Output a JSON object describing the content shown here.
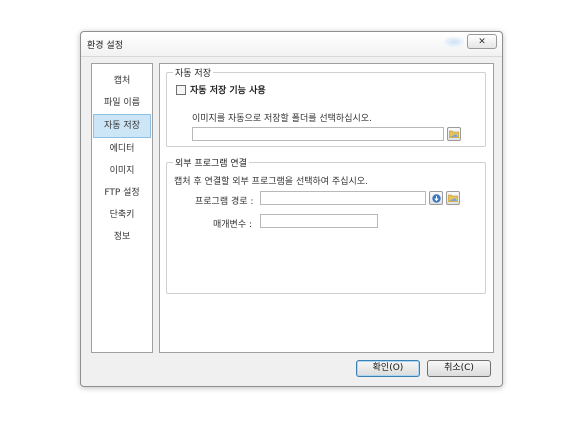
{
  "window": {
    "title": "환경 설정",
    "close_label": "✕"
  },
  "sidebar": {
    "items": [
      {
        "label": "캡처"
      },
      {
        "label": "파일 이름"
      },
      {
        "label": "자동 저장"
      },
      {
        "label": "에디터"
      },
      {
        "label": "이미지"
      },
      {
        "label": "FTP 설정"
      },
      {
        "label": "단축키"
      },
      {
        "label": "정보"
      }
    ],
    "selected": "자동 저장"
  },
  "autosave": {
    "group_label": "자동 저장",
    "checkbox_label": "자동 저장 기능 사용",
    "checkbox_checked": false,
    "description": "이미지를 자동으로 저장할 폴더를 선택하십시오.",
    "folder_value": ""
  },
  "external": {
    "group_label": "외부 프로그램 연결",
    "description": "캡처 후 연결할 외부 프로그램을 선택하여 주십시오.",
    "program_path_label": "프로그램 경로 :",
    "program_path_value": "",
    "params_label": "매개변수 :",
    "params_value": ""
  },
  "buttons": {
    "ok": "확인(O)",
    "cancel": "취소(C)"
  },
  "icons": {
    "folder_browse": "folder-icon",
    "download_arrow": "arrow-down-icon",
    "program_browse": "folder-icon"
  },
  "colors": {
    "selection": "#cde6f7",
    "accent": "#3c7fb1"
  }
}
